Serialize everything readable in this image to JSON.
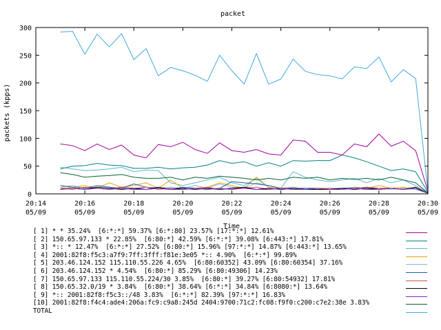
{
  "chart_data": {
    "type": "line",
    "title": "packet",
    "xlabel": "Time",
    "ylabel": "packets (kpps)",
    "ylim": [
      0,
      300
    ],
    "xlim": [
      "05/09 20:14",
      "05/09 20:30"
    ],
    "yticks": [
      "0",
      "50",
      "100",
      "150",
      "200",
      "250",
      "300"
    ],
    "xticks": [
      {
        "time": "20:14",
        "date": "05/09"
      },
      {
        "time": "20:16",
        "date": "05/09"
      },
      {
        "time": "20:18",
        "date": "05/09"
      },
      {
        "time": "20:20",
        "date": "05/09"
      },
      {
        "time": "20:22",
        "date": "05/09"
      },
      {
        "time": "20:24",
        "date": "05/09"
      },
      {
        "time": "20:26",
        "date": "05/09"
      },
      {
        "time": "20:28",
        "date": "05/09"
      },
      {
        "time": "20:30",
        "date": "05/09"
      }
    ],
    "x": [
      "20:15:00",
      "20:15:30",
      "20:16:00",
      "20:16:30",
      "20:17:00",
      "20:17:30",
      "20:18:00",
      "20:18:30",
      "20:19:00",
      "20:19:30",
      "20:20:00",
      "20:20:30",
      "20:21:00",
      "20:21:30",
      "20:22:00",
      "20:22:30",
      "20:23:00",
      "20:23:30",
      "20:24:00",
      "20:24:30",
      "20:25:00",
      "20:25:30",
      "20:26:00",
      "20:26:30",
      "20:27:00",
      "20:27:30",
      "20:28:00",
      "20:28:30",
      "20:29:00",
      "20:29:30",
      "20:30:00"
    ],
    "grid": false,
    "legend_position": "bottom",
    "series": [
      {
        "name": "[ 1] * * 35.24%  [6:*:*] 59.37% [6:*:80] 23.57% [17:*:*] 12.61%",
        "color": "#a000a0",
        "values": [
          90,
          87,
          78,
          90,
          80,
          88,
          70,
          65,
          89,
          85,
          93,
          80,
          73,
          92,
          78,
          75,
          80,
          72,
          70,
          97,
          95,
          75,
          75,
          70,
          90,
          85,
          108,
          86,
          95,
          78,
          5
        ]
      },
      {
        "name": "[ 2] 150.65.97.133 * 22.85%  [6:80:*] 42.59% [6:*:*] 39.08% [6:443:*] 17.81%",
        "color": "#008080",
        "values": [
          45,
          50,
          51,
          55,
          52,
          51,
          46,
          46,
          48,
          45,
          47,
          48,
          52,
          60,
          55,
          58,
          50,
          56,
          50,
          60,
          59,
          60,
          60,
          70,
          65,
          58,
          50,
          42,
          45,
          40,
          3
        ]
      },
      {
        "name": "[ 3] *:: * 12.47%  [6:*:*] 27.52% [6:80:*] 15.96% [97:*:*] 14.87% [6:443:*] 13.65%",
        "color": "#5ab4d2",
        "values": [
          48,
          45,
          42,
          43,
          45,
          48,
          40,
          43,
          42,
          20,
          15,
          20,
          25,
          30,
          20,
          15,
          28,
          12,
          10,
          40,
          30,
          25,
          22,
          25,
          28,
          20,
          28,
          20,
          25,
          15,
          2
        ]
      },
      {
        "name": "[ 4] 2001:82f8:f5c3:a7f9:7ff:3fff:f81e:3e05 *:: 4.90%  [6:*:*] 99.89%",
        "color": "#e8a000",
        "values": [
          10,
          12,
          15,
          10,
          20,
          12,
          15,
          20,
          10,
          25,
          10,
          8,
          12,
          20,
          15,
          10,
          30,
          12,
          10,
          12,
          10,
          10,
          10,
          8,
          12,
          10,
          15,
          10,
          12,
          8,
          1
        ]
      },
      {
        "name": "[ 5] 203.46.124.152 115.110.55.226 4.65%  [6:80:60352] 43.09% [6:80:60354] 37.16%",
        "color": "#8cb4c8",
        "values": [
          12,
          15,
          10,
          12,
          10,
          12,
          8,
          12,
          10,
          12,
          10,
          15,
          10,
          18,
          12,
          10,
          20,
          15,
          10,
          12,
          10,
          8,
          10,
          10,
          12,
          10,
          10,
          8,
          10,
          8,
          1
        ]
      },
      {
        "name": "[ 6] 203.46.124.152 * 4.54%  [6:80:*] 85.29% [6:80:49306] 14.23%",
        "color": "#1e5ab4",
        "values": [
          15,
          12,
          10,
          15,
          12,
          10,
          18,
          12,
          10,
          8,
          12,
          10,
          8,
          10,
          22,
          20,
          18,
          15,
          10,
          8,
          10,
          10,
          8,
          10,
          10,
          12,
          8,
          10,
          8,
          10,
          1
        ]
      },
      {
        "name": "[ 7] 150.65.97.133 115.110.55.224/30 3.85%  [6:80:*] 39.27% [6:80:54932] 17.81%",
        "color": "#c84b4b",
        "values": [
          10,
          8,
          12,
          10,
          8,
          12,
          10,
          12,
          8,
          10,
          8,
          10,
          12,
          8,
          10,
          10,
          12,
          8,
          10,
          10,
          8,
          8,
          10,
          8,
          10,
          12,
          10,
          10,
          8,
          10,
          1
        ]
      },
      {
        "name": "[ 8] 150.65.32.0/19 * 3.84%  [6:80:*] 38.64% [6:*:*] 34.84% [6:8080:*] 13.64%",
        "color": "#000000",
        "values": [
          8,
          10,
          8,
          12,
          10,
          8,
          10,
          8,
          12,
          8,
          10,
          8,
          10,
          8,
          10,
          12,
          8,
          10,
          8,
          10,
          8,
          8,
          8,
          10,
          8,
          10,
          8,
          10,
          8,
          12,
          1
        ]
      },
      {
        "name": "[ 9] *:: 2001:82f8:f5c3::/48 3.83%  [6:*:*] 82.39% [97:*:*] 16.83%",
        "color": "#8020c0",
        "values": [
          8,
          10,
          8,
          10,
          8,
          10,
          8,
          8,
          10,
          8,
          8,
          10,
          8,
          10,
          8,
          10,
          8,
          8,
          10,
          8,
          8,
          10,
          8,
          8,
          10,
          8,
          8,
          10,
          8,
          10,
          1
        ]
      },
      {
        "name": "[10] 2001:82f8:f4c4:ade4:206a:fc9:c9a8:245d 2404:9700:71c2:fc08:f9f0:c200:c7e2:38e 3.83%",
        "color": "#006432",
        "values": [
          38,
          35,
          30,
          32,
          33,
          35,
          30,
          28,
          28,
          30,
          25,
          30,
          28,
          32,
          30,
          28,
          25,
          28,
          25,
          30,
          28,
          30,
          25,
          28,
          26,
          28,
          25,
          30,
          25,
          20,
          2
        ]
      },
      {
        "name": "TOTAL",
        "color": "#40a8e0",
        "values": [
          292,
          293,
          252,
          288,
          265,
          289,
          242,
          262,
          213,
          228,
          222,
          214,
          203,
          250,
          222,
          198,
          253,
          198,
          207,
          243,
          221,
          215,
          213,
          207,
          229,
          226,
          247,
          202,
          224,
          208,
          5
        ]
      }
    ]
  }
}
